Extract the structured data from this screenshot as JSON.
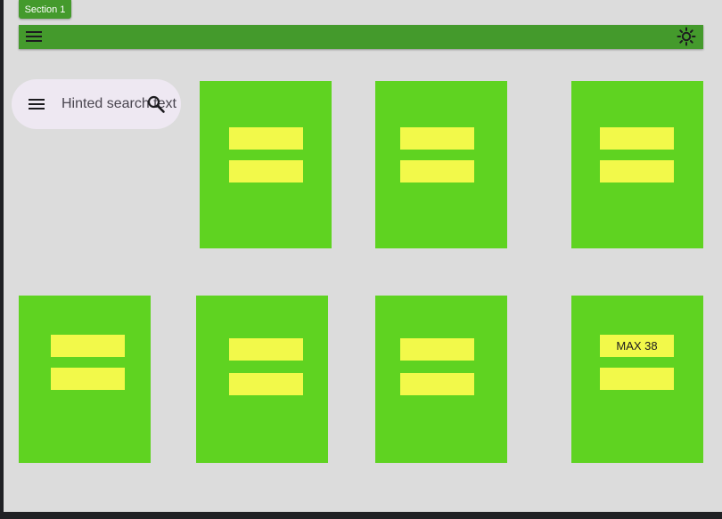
{
  "section": {
    "label": "Section 1"
  },
  "appbar": {
    "menu_icon": "menu-icon",
    "theme_icon": "brightness-icon"
  },
  "search": {
    "placeholder": "Hinted search text",
    "menu_icon": "menu-icon",
    "search_icon": "search-icon"
  },
  "colors": {
    "background": "#dcdcdc",
    "appbar": "#449a2c",
    "card": "#5fd321",
    "pill": "#f2f94a",
    "search_bg": "#eee8f2"
  },
  "cards": [
    {
      "pill1": "",
      "pill2": ""
    },
    {
      "pill1": "",
      "pill2": ""
    },
    {
      "pill1": "",
      "pill2": ""
    },
    {
      "pill1": "",
      "pill2": ""
    },
    {
      "pill1": "",
      "pill2": ""
    },
    {
      "pill1": "",
      "pill2": ""
    },
    {
      "pill1": "MAX 38",
      "pill2": ""
    }
  ]
}
